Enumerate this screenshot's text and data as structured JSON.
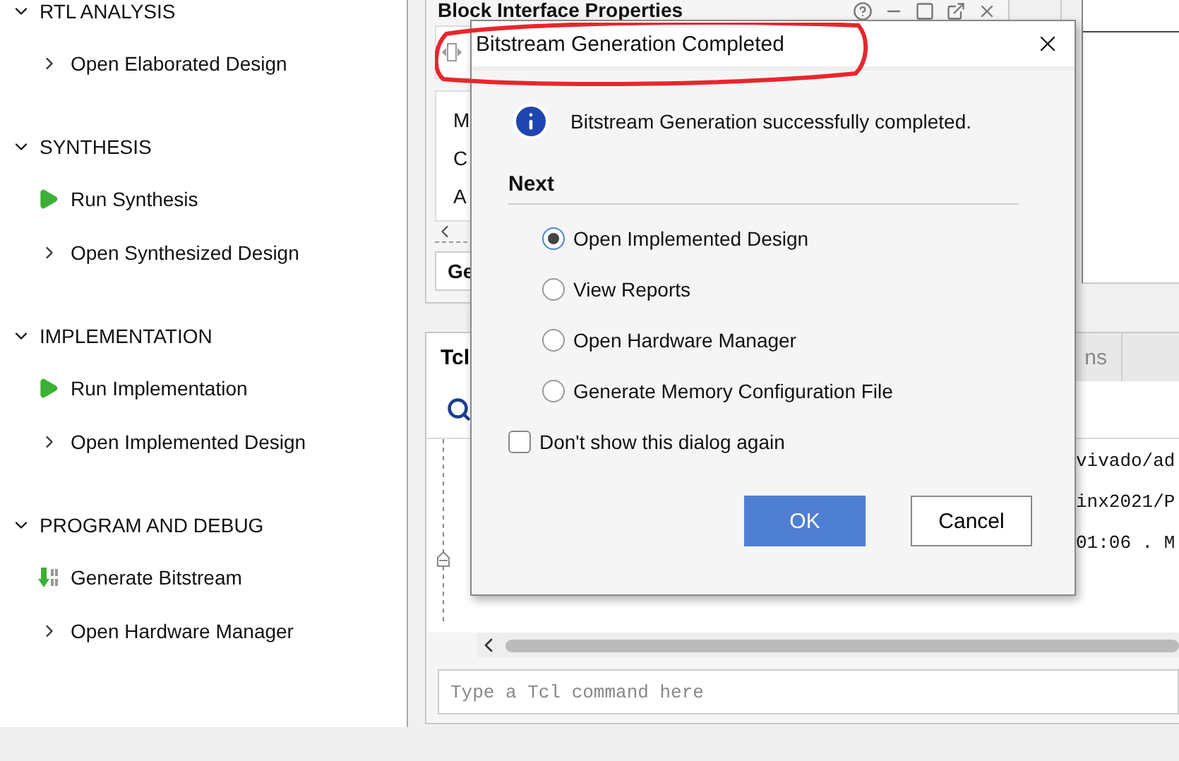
{
  "flow_navigator": {
    "sections": [
      {
        "title": "RTL ANALYSIS",
        "expanded": true,
        "items": [
          {
            "kind": "open",
            "label": "Open Elaborated Design"
          }
        ]
      },
      {
        "title": "SYNTHESIS",
        "expanded": true,
        "items": [
          {
            "kind": "run",
            "label": "Run Synthesis"
          },
          {
            "kind": "open",
            "label": "Open Synthesized Design"
          }
        ]
      },
      {
        "title": "IMPLEMENTATION",
        "expanded": true,
        "items": [
          {
            "kind": "run",
            "label": "Run Implementation"
          },
          {
            "kind": "open",
            "label": "Open Implemented Design"
          }
        ]
      },
      {
        "title": "PROGRAM AND DEBUG",
        "expanded": true,
        "items": [
          {
            "kind": "bitstream",
            "label": "Generate Bitstream"
          },
          {
            "kind": "open",
            "label": "Open Hardware Manager"
          }
        ]
      }
    ]
  },
  "properties_panel": {
    "title": "Block Interface Properties",
    "rows": [
      "M",
      "C",
      "A"
    ],
    "tab": "Ge"
  },
  "tcl_console": {
    "tabs": [
      {
        "label": "Tcl",
        "selected": true
      },
      {
        "label": "ns",
        "selected": false
      }
    ],
    "lines": [
      "vivado/ad",
      "inx2021/P",
      "01:06 . M"
    ],
    "input": {
      "placeholder": "Type a Tcl command here"
    }
  },
  "dialog": {
    "title": "Bitstream Generation Completed",
    "message": "Bitstream Generation successfully completed.",
    "section": "Next",
    "options": [
      {
        "label": "Open Implemented Design",
        "selected": true
      },
      {
        "label": "View Reports",
        "selected": false
      },
      {
        "label": "Open Hardware Manager",
        "selected": false
      },
      {
        "label": "Generate Memory Configuration File",
        "selected": false
      }
    ],
    "checkbox": {
      "label": "Don't show this dialog again",
      "checked": false
    },
    "buttons": [
      {
        "label": "OK",
        "primary": true
      },
      {
        "label": "Cancel",
        "primary": false
      }
    ]
  }
}
